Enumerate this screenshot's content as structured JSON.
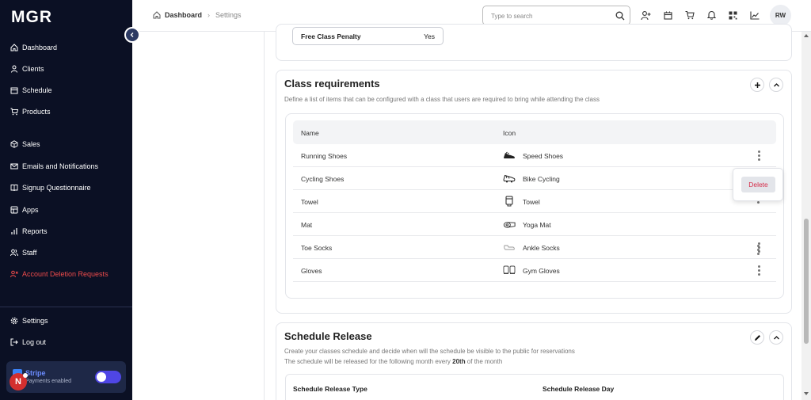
{
  "app": {
    "logo": "MGR"
  },
  "sidebar": {
    "items": [
      {
        "label": "Dashboard",
        "icon": "home-icon"
      },
      {
        "label": "Clients",
        "icon": "user-icon"
      },
      {
        "label": "Schedule",
        "icon": "calendar-icon"
      },
      {
        "label": "Products",
        "icon": "cart-icon"
      },
      {
        "label": "Sales",
        "icon": "box-icon"
      },
      {
        "label": "Emails and Notifications",
        "icon": "mail-icon"
      },
      {
        "label": "Signup Questionnaire",
        "icon": "book-icon"
      },
      {
        "label": "Apps",
        "icon": "apps-icon"
      },
      {
        "label": "Reports",
        "icon": "bar-chart-icon"
      },
      {
        "label": "Staff",
        "icon": "users-icon"
      },
      {
        "label": "Account Deletion Requests",
        "icon": "user-x-icon"
      }
    ],
    "bottom": [
      {
        "label": "Settings",
        "icon": "gear-icon"
      },
      {
        "label": "Log out",
        "icon": "logout-icon"
      }
    ],
    "stripe": {
      "name": "Stripe",
      "status": "Payments enabled"
    },
    "badge": "N"
  },
  "header": {
    "breadcrumb": {
      "home": "Dashboard",
      "current": "Settings"
    },
    "search_placeholder": "Type to search",
    "avatar": "RW"
  },
  "penalty": {
    "label": "Free Class Penalty",
    "value": "Yes"
  },
  "class_requirements": {
    "title": "Class requirements",
    "description": "Define a list of items that can be configured with a class that users are required to bring while attending the class",
    "columns": [
      "Name",
      "Icon"
    ],
    "rows": [
      {
        "name": "Running Shoes",
        "icon": "Speed Shoes"
      },
      {
        "name": "Cycling Shoes",
        "icon": "Bike Cycling"
      },
      {
        "name": "Towel",
        "icon": "Towel"
      },
      {
        "name": "Mat",
        "icon": "Yoga Mat"
      },
      {
        "name": "Toe Socks",
        "icon": "Ankle Socks"
      },
      {
        "name": "Gloves",
        "icon": "Gym Gloves"
      }
    ],
    "popup_action": "Delete"
  },
  "schedule_release": {
    "title": "Schedule Release",
    "desc_line1": "Create your classes schedule and decide when will the schedule be visible to the public for reservations",
    "desc_line2_pre": "The schedule will be released for the following month every ",
    "desc_line2_bold": "20th",
    "desc_line2_post": " of the month",
    "col1": "Schedule Release Type",
    "col2": "Schedule Release Day"
  },
  "colors": {
    "sidebar_bg": "#0b1024",
    "danger": "#ef4b4b",
    "toggle": "#4f46e5"
  }
}
